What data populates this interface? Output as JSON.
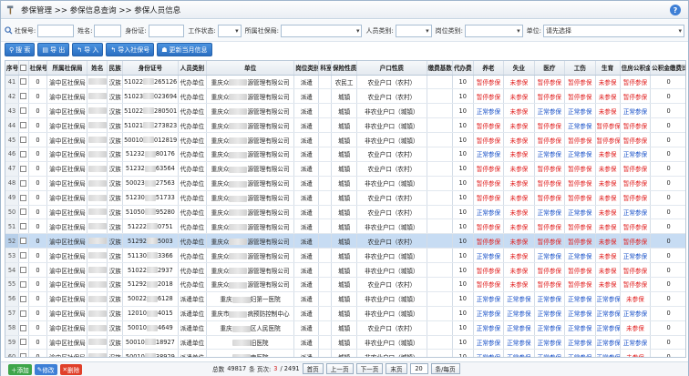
{
  "title": {
    "breadcrumb": "参保管理 >> 参保信息查询 >> 参保人员信息",
    "help": "?"
  },
  "search": {
    "ss_no_label": "社保号:",
    "name_label": "姓名:",
    "id_label": "身份证:",
    "work_status_label": "工作状态:",
    "belong_ss_label": "所属社保局:",
    "person_type_label": "人员类别:",
    "post_type_label": "岗位类别:",
    "unit_label": "单位:",
    "unit_value": "请先选择"
  },
  "toolbar": {
    "search": "搜 索",
    "export": "导 出",
    "import": "导 入",
    "import_ss": "导入社保号",
    "update_month": "更新当月信息"
  },
  "columns": [
    "序号",
    "社保号",
    "所属社保局",
    "姓名",
    "民族",
    "身份证号",
    "人员类别",
    "单位",
    "岗位类别",
    "科室",
    "保险性质",
    "户口性质",
    "缴费基数",
    "代办费",
    "养老",
    "失业",
    "医疗",
    "工伤",
    "生育",
    "住房公积金",
    "公积金缴费比"
  ],
  "rows": [
    {
      "no": "41",
      "ss": "0",
      "bureau": "渝中区社保局",
      "eth": "汉族",
      "id_a": "51022",
      "id_b": "265126",
      "ptype": "代办单位",
      "unit_a": "重庆众",
      "unit_b": "源管理有限公司",
      "post": "派遣",
      "ins": "农民工",
      "hukou": "农业户口（农村）",
      "fee": "10",
      "yl": "暂停参保",
      "sy": "未参保",
      "ylx": "暂停参保",
      "gs": "暂停参保",
      "syu": "未参保",
      "gjj": "暂停参保",
      "ratio": "0"
    },
    {
      "no": "42",
      "ss": "0",
      "bureau": "渝中区社保局",
      "eth": "汉族",
      "id_a": "51023",
      "id_b": "023694",
      "ptype": "代办单位",
      "unit_a": "重庆众",
      "unit_b": "源管理有限公司",
      "post": "派遣",
      "ins": "城镇",
      "hukou": "农业户口（农村）",
      "fee": "10",
      "yl": "暂停参保",
      "sy": "未参保",
      "ylx": "暂停参保",
      "gs": "暂停参保",
      "syu": "未参保",
      "gjj": "暂停参保",
      "ratio": "0"
    },
    {
      "no": "43",
      "ss": "0",
      "bureau": "渝中区社保局",
      "eth": "汉族",
      "id_a": "51022",
      "id_b": "280501",
      "ptype": "代办单位",
      "unit_a": "重庆众",
      "unit_b": "源管理有限公司",
      "post": "派遣",
      "ins": "城镇",
      "hukou": "非农业户口（城镇）",
      "fee": "10",
      "yl": "正常参保",
      "sy": "未参保",
      "ylx": "正常参保",
      "gs": "正常参保",
      "syu": "未参保",
      "gjj": "正常参保",
      "ratio": "0"
    },
    {
      "no": "44",
      "ss": "0",
      "bureau": "渝中区社保局",
      "eth": "汉族",
      "id_a": "51021",
      "id_b": "273823",
      "ptype": "代办单位",
      "unit_a": "重庆众",
      "unit_b": "源管理有限公司",
      "post": "派遣",
      "ins": "城镇",
      "hukou": "非农业户口（城镇）",
      "fee": "10",
      "yl": "暂停参保",
      "sy": "未参保",
      "ylx": "暂停参保",
      "gs": "正常参保",
      "syu": "暂停参保",
      "gjj": "暂停参保",
      "ratio": "0"
    },
    {
      "no": "45",
      "ss": "0",
      "bureau": "渝中区社保局",
      "eth": "汉族",
      "id_a": "50010",
      "id_b": "012819",
      "ptype": "代办单位",
      "unit_a": "重庆众",
      "unit_b": "源管理有限公司",
      "post": "派遣",
      "ins": "城镇",
      "hukou": "非农业户口（城镇）",
      "fee": "10",
      "yl": "暂停参保",
      "sy": "未参保",
      "ylx": "暂停参保",
      "gs": "暂停参保",
      "syu": "暂停参保",
      "gjj": "暂停参保",
      "ratio": "0"
    },
    {
      "no": "46",
      "ss": "0",
      "bureau": "渝中区社保局",
      "eth": "汉族",
      "id_a": "51232",
      "id_b": "80176",
      "ptype": "代办单位",
      "unit_a": "重庆众",
      "unit_b": "源管理有限公司",
      "post": "派遣",
      "ins": "城镇",
      "hukou": "农业户口（农村）",
      "fee": "10",
      "yl": "正常参保",
      "sy": "未参保",
      "ylx": "正常参保",
      "gs": "正常参保",
      "syu": "未参保",
      "gjj": "正常参保",
      "ratio": "0"
    },
    {
      "no": "47",
      "ss": "0",
      "bureau": "渝中区社保局",
      "eth": "汉族",
      "id_a": "51232",
      "id_b": "63564",
      "ptype": "代办单位",
      "unit_a": "重庆众",
      "unit_b": "源管理有限公司",
      "post": "派遣",
      "ins": "城镇",
      "hukou": "农业户口（农村）",
      "fee": "10",
      "yl": "暂停参保",
      "sy": "未参保",
      "ylx": "暂停参保",
      "gs": "暂停参保",
      "syu": "未参保",
      "gjj": "暂停参保",
      "ratio": "0"
    },
    {
      "no": "48",
      "ss": "0",
      "bureau": "渝中区社保局",
      "eth": "汉族",
      "id_a": "50023",
      "id_b": "27563",
      "ptype": "代办单位",
      "unit_a": "重庆众",
      "unit_b": "源管理有限公司",
      "post": "派遣",
      "ins": "城镇",
      "hukou": "非农业户口（城镇）",
      "fee": "10",
      "yl": "暂停参保",
      "sy": "未参保",
      "ylx": "暂停参保",
      "gs": "暂停参保",
      "syu": "未参保",
      "gjj": "暂停参保",
      "ratio": "0"
    },
    {
      "no": "49",
      "ss": "0",
      "bureau": "渝中区社保局",
      "eth": "汉族",
      "id_a": "51230",
      "id_b": "51733",
      "ptype": "代办单位",
      "unit_a": "重庆众",
      "unit_b": "源管理有限公司",
      "post": "派遣",
      "ins": "城镇",
      "hukou": "农业户口（农村）",
      "fee": "10",
      "yl": "暂停参保",
      "sy": "未参保",
      "ylx": "暂停参保",
      "gs": "暂停参保",
      "syu": "未参保",
      "gjj": "暂停参保",
      "ratio": "0"
    },
    {
      "no": "50",
      "ss": "0",
      "bureau": "渝中区社保局",
      "eth": "汉族",
      "id_a": "51050",
      "id_b": "95280",
      "ptype": "代办单位",
      "unit_a": "重庆众",
      "unit_b": "源管理有限公司",
      "post": "派遣",
      "ins": "城镇",
      "hukou": "农业户口（农村）",
      "fee": "10",
      "yl": "正常参保",
      "sy": "未参保",
      "ylx": "正常参保",
      "gs": "正常参保",
      "syu": "未参保",
      "gjj": "正常参保",
      "ratio": "0"
    },
    {
      "no": "51",
      "ss": "0",
      "bureau": "渝中区社保局",
      "eth": "汉族",
      "id_a": "51222",
      "id_b": "0751",
      "ptype": "代办单位",
      "unit_a": "重庆众",
      "unit_b": "源管理有限公司",
      "post": "派遣",
      "ins": "城镇",
      "hukou": "非农业户口（城镇）",
      "fee": "10",
      "yl": "暂停参保",
      "sy": "未参保",
      "ylx": "暂停参保",
      "gs": "暂停参保",
      "syu": "未参保",
      "gjj": "暂停参保",
      "ratio": "0"
    },
    {
      "no": "52",
      "ss": "0",
      "bureau": "渝中区社保局",
      "eth": "汉族",
      "id_a": "51292",
      "id_b": "5003",
      "ptype": "代办单位",
      "unit_a": "重庆众",
      "unit_b": "源管理有限公司",
      "post": "派遣",
      "ins": "城镇",
      "hukou": "农业户口（农村）",
      "fee": "10",
      "yl": "暂停参保",
      "sy": "未参保",
      "ylx": "暂停参保",
      "gs": "暂停参保",
      "syu": "未参保",
      "gjj": "暂停参保",
      "ratio": "0",
      "selected": true
    },
    {
      "no": "53",
      "ss": "0",
      "bureau": "渝中区社保局",
      "eth": "汉族",
      "id_a": "51130",
      "id_b": "3366",
      "ptype": "代办单位",
      "unit_a": "重庆众",
      "unit_b": "源管理有限公司",
      "post": "派遣",
      "ins": "城镇",
      "hukou": "非农业户口（城镇）",
      "fee": "10",
      "yl": "正常参保",
      "sy": "未参保",
      "ylx": "正常参保",
      "gs": "正常参保",
      "syu": "未参保",
      "gjj": "正常参保",
      "ratio": "0"
    },
    {
      "no": "54",
      "ss": "0",
      "bureau": "渝中区社保局",
      "eth": "汉族",
      "id_a": "51022",
      "id_b": "2937",
      "ptype": "代办单位",
      "unit_a": "重庆众",
      "unit_b": "源管理有限公司",
      "post": "派遣",
      "ins": "城镇",
      "hukou": "非农业户口（城镇）",
      "fee": "10",
      "yl": "暂停参保",
      "sy": "未参保",
      "ylx": "暂停参保",
      "gs": "暂停参保",
      "syu": "未参保",
      "gjj": "暂停参保",
      "ratio": "0"
    },
    {
      "no": "55",
      "ss": "0",
      "bureau": "渝中区社保局",
      "eth": "汉族",
      "id_a": "51292",
      "id_b": "2018",
      "ptype": "代办单位",
      "unit_a": "重庆众",
      "unit_b": "源管理有限公司",
      "post": "派遣",
      "ins": "城镇",
      "hukou": "农业户口（农村）",
      "fee": "10",
      "yl": "暂停参保",
      "sy": "未参保",
      "ylx": "暂停参保",
      "gs": "暂停参保",
      "syu": "未参保",
      "gjj": "暂停参保",
      "ratio": "0"
    },
    {
      "no": "56",
      "ss": "0",
      "bureau": "渝中区社保局",
      "eth": "汉族",
      "id_a": "50022",
      "id_b": "6128",
      "ptype": "派遣单位",
      "unit_a": "重庆",
      "unit_b": "妇第一医院",
      "post": "派遣",
      "ins": "城镇",
      "hukou": "非农业户口（城镇）",
      "fee": "10",
      "yl": "正常参保",
      "sy": "正常参保",
      "ylx": "正常参保",
      "gs": "正常参保",
      "syu": "正常参保",
      "gjj": "未参保",
      "ratio": "0"
    },
    {
      "no": "57",
      "ss": "0",
      "bureau": "渝中区社保局",
      "eth": "汉族",
      "id_a": "12010",
      "id_b": "4015",
      "ptype": "派遣单位",
      "unit_a": "重庆市",
      "unit_b": "病预防控制中心",
      "post": "派遣",
      "ins": "城镇",
      "hukou": "非农业户口（城镇）",
      "fee": "10",
      "yl": "正常参保",
      "sy": "正常参保",
      "ylx": "正常参保",
      "gs": "正常参保",
      "syu": "正常参保",
      "gjj": "正常参保",
      "ratio": "0"
    },
    {
      "no": "58",
      "ss": "0",
      "bureau": "渝中区社保局",
      "eth": "汉族",
      "id_a": "50010",
      "id_b": "4649",
      "ptype": "派遣单位",
      "unit_a": "重庆",
      "unit_b": "区人民医院",
      "post": "派遣",
      "ins": "城镇",
      "hukou": "农业户口（农村）",
      "fee": "10",
      "yl": "正常参保",
      "sy": "正常参保",
      "ylx": "正常参保",
      "gs": "正常参保",
      "syu": "正常参保",
      "gjj": "未参保",
      "ratio": "0"
    },
    {
      "no": "59",
      "ss": "0",
      "bureau": "渝中区社保局",
      "eth": "汉族",
      "id_a": "50010",
      "id_b": "18927",
      "ptype": "派遣单位",
      "unit_a": "",
      "unit_b": "旧医院",
      "post": "派遣",
      "ins": "城镇",
      "hukou": "非农业户口（城镇）",
      "fee": "10",
      "yl": "正常参保",
      "sy": "正常参保",
      "ylx": "正常参保",
      "gs": "正常参保",
      "syu": "正常参保",
      "gjj": "正常参保",
      "ratio": "0"
    },
    {
      "no": "60",
      "ss": "0",
      "bureau": "渝中区社保局",
      "eth": "汉族",
      "id_a": "50010",
      "id_b": "38929",
      "ptype": "派遣单位",
      "unit_a": "",
      "unit_b": "南医院",
      "post": "派遣",
      "ins": "城镇",
      "hukou": "非农业户口（城镇）",
      "fee": "10",
      "yl": "正常参保",
      "sy": "正常参保",
      "ylx": "正常参保",
      "gs": "正常参保",
      "syu": "正常参保",
      "gjj": "未参保",
      "ratio": "0"
    }
  ],
  "status_colors": {
    "正常参保": "#1a52c8",
    "暂停参保": "#e01b1b",
    "未参保": "#e01b1b"
  },
  "footer": {
    "add": "添加",
    "edit": "修改",
    "delete": "删除",
    "total_prefix": "总数",
    "total": "49817",
    "total_suffix": "条 页次:",
    "page_current": "3",
    "page_total": "/ 2491",
    "first": "首页",
    "prev": "上一页",
    "next": "下一页",
    "last": "末页",
    "page_size": "20",
    "page_size_suffix": "条/每页"
  }
}
